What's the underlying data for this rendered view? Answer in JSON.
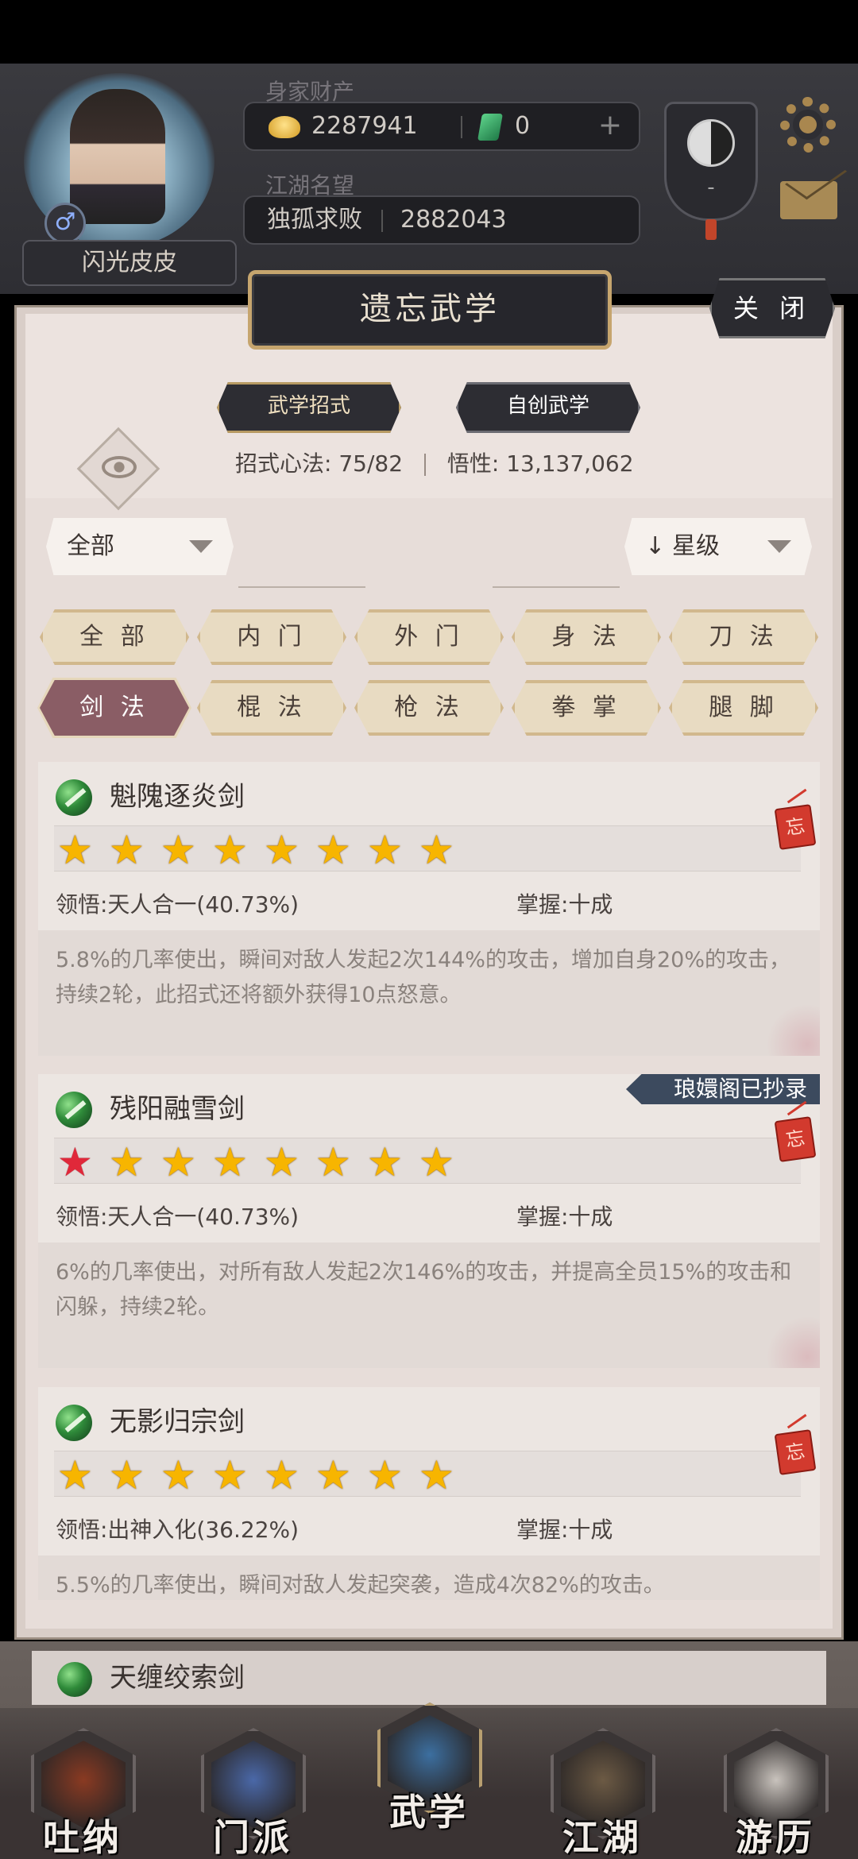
{
  "header": {
    "player_name": "闪光皮皮",
    "gender_symbol": "♂",
    "wealth_label": "身家财产",
    "gold": "2287941",
    "jade": "0",
    "plus": "+",
    "reputation_label": "江湖名望",
    "title": "独孤求败",
    "reputation": "2882043",
    "taiji_dash": "-"
  },
  "panel": {
    "title": "遗忘武学",
    "close_label": "关 闭",
    "tabs": [
      "武学招式",
      "自创武学"
    ],
    "stats_label_1": "招式心法:",
    "stats_value_1": "75/82",
    "stats_label_2": "悟性:",
    "stats_value_2": "13,137,062",
    "filter_left": "全部",
    "filter_right": "星级",
    "sort_arrow": "↓",
    "categories_row1": [
      "全 部",
      "内 门",
      "外 门",
      "身 法",
      "刀 法"
    ],
    "categories_row2": [
      "剑 法",
      "棍 法",
      "枪 法",
      "拳 掌",
      "腿 脚"
    ],
    "active_category": "剑 法"
  },
  "skills": [
    {
      "name": "魁隗逐炎剑",
      "stars": 8,
      "red_stars": 0,
      "comprehension": "领悟:天人合一(40.73%)",
      "mastery": "掌握:十成",
      "description": "5.8%的几率使出，瞬间对敌人发起2次144%的攻击，增加自身20%的攻击，持续2轮，此招式还将额外获得10点怒意。",
      "stamp": "忘",
      "ribbon": ""
    },
    {
      "name": "残阳融雪剑",
      "stars": 8,
      "red_stars": 1,
      "comprehension": "领悟:天人合一(40.73%)",
      "mastery": "掌握:十成",
      "description": "6%的几率使出，对所有敌人发起2次146%的攻击，并提高全员15%的攻击和闪躲，持续2轮。",
      "stamp": "忘",
      "ribbon": "琅嬛阁已抄录"
    },
    {
      "name": "无影归宗剑",
      "stars": 8,
      "red_stars": 0,
      "comprehension": "领悟:出神入化(36.22%)",
      "mastery": "掌握:十成",
      "description": "5.5%的几率使出，瞬间对敌人发起突袭，造成4次82%的攻击。",
      "stamp": "忘",
      "ribbon": ""
    }
  ],
  "peek_skill": "天缠绞索剑",
  "nav": [
    {
      "label": "吐纳",
      "icon": "meditation-icon",
      "color": "#8a3a22"
    },
    {
      "label": "门派",
      "icon": "sect-icon",
      "color": "#4a68a8"
    },
    {
      "label": "武学",
      "icon": "martial-book-icon",
      "color": "#3c6fa0"
    },
    {
      "label": "江湖",
      "icon": "straw-hat-icon",
      "color": "#6c5a44"
    },
    {
      "label": "游历",
      "icon": "horse-icon",
      "color": "#c9c3bd"
    }
  ],
  "selected_nav": "武学",
  "colors": {
    "accent_gold": "#c6a56e",
    "active_category": "#8a5d65",
    "star": "#f7b500",
    "star_red": "#e0283a"
  }
}
